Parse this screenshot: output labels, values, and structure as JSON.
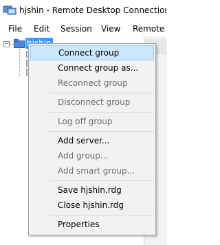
{
  "window": {
    "title": "hjshin - Remote Desktop Connection M"
  },
  "menubar": {
    "items": [
      "File",
      "Edit",
      "Session",
      "View",
      "Remote D"
    ]
  },
  "tree": {
    "root_label": "hjshin",
    "expander_symbol": "−",
    "selection_color": "#3399ff"
  },
  "context_menu": {
    "items": [
      {
        "label": "Connect group",
        "enabled": true,
        "highlighted": true
      },
      {
        "label": "Connect group as...",
        "enabled": true
      },
      {
        "label": "Reconnect group",
        "enabled": false
      },
      {
        "label": "Disconnect group",
        "enabled": false
      },
      {
        "label": "Log off group",
        "enabled": false
      },
      {
        "label": "Add server...",
        "enabled": true
      },
      {
        "label": "Add group...",
        "enabled": false
      },
      {
        "label": "Add smart group...",
        "enabled": false
      },
      {
        "label": "Save hjshin.rdg",
        "enabled": true
      },
      {
        "label": "Close hjshin.rdg",
        "enabled": true
      },
      {
        "label": "Properties",
        "enabled": true
      }
    ]
  }
}
